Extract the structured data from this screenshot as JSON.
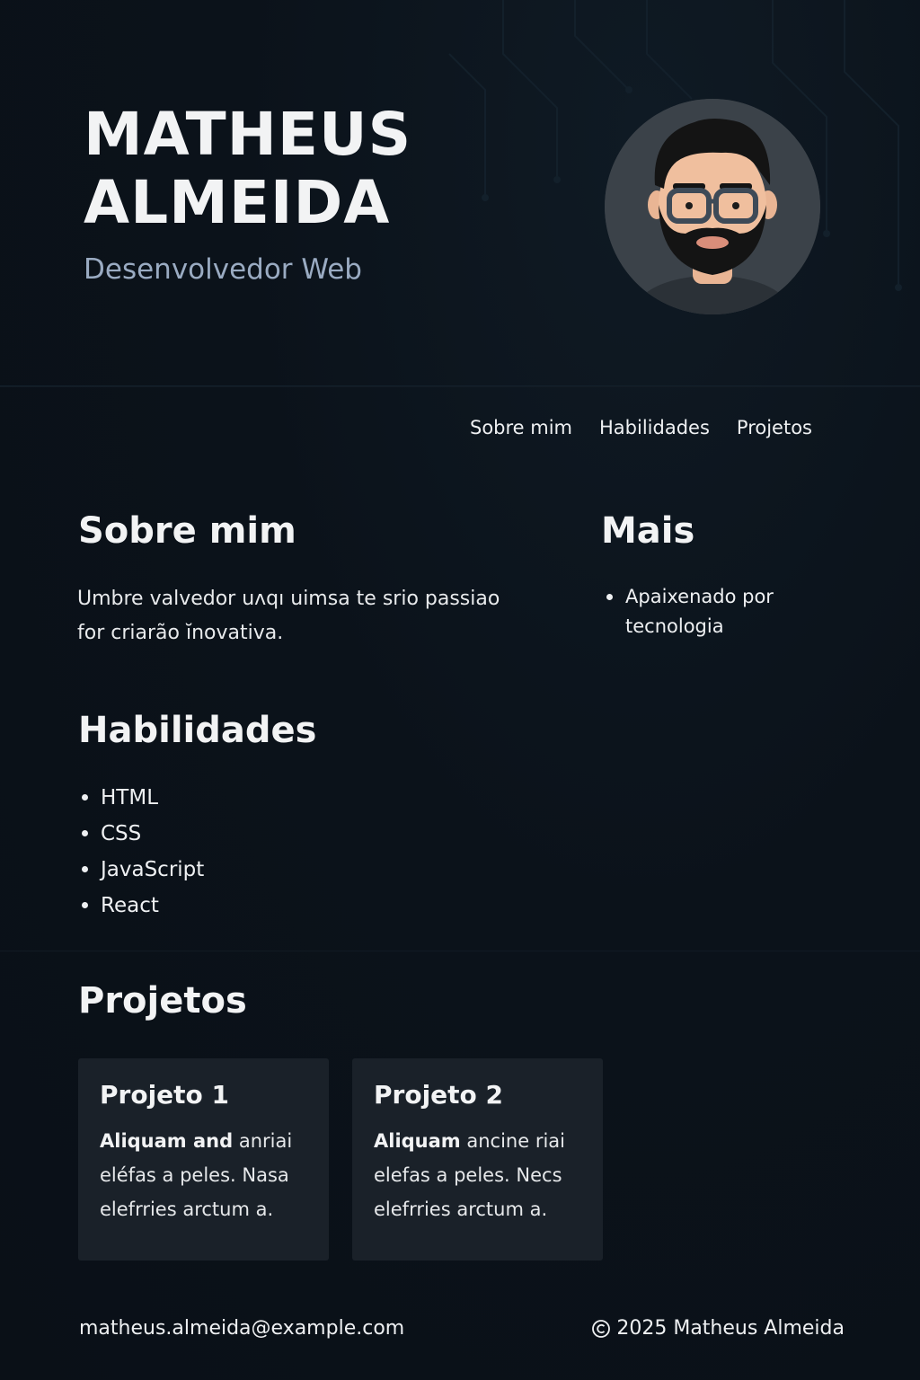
{
  "header": {
    "name_line1": "MATHEUS",
    "name_line2": "ALMEIDA",
    "subtitle": "Desenvolvedor Web"
  },
  "nav": {
    "items": [
      "Sobre mim",
      "Habilidades",
      "Projetos"
    ]
  },
  "about": {
    "title": "Sobre mim",
    "text": "Umbre valvedor uʌqı uimsa te srio passiao for criarão ĭnovativa."
  },
  "more": {
    "title": "Mais",
    "items": [
      "Apaixenado por tecnologia"
    ]
  },
  "skills": {
    "title": "Habilidades",
    "items": [
      "HTML",
      "CSS",
      "JavaScript",
      "React"
    ]
  },
  "projects": {
    "title": "Projetos",
    "items": [
      {
        "title": "Projeto 1",
        "lead": "Aliquam and",
        "text": " anriai eléfas a peles. Nasa elefrries arctum a."
      },
      {
        "title": "Projeto 2",
        "lead": "Aliquam",
        "text": " ancine riai elefas a peles. Necs elefrries arctum a."
      }
    ]
  },
  "footer": {
    "email": "matheus.almeida@example.com",
    "copyright": "2025 Matheus Almeida",
    "copyright_icon": "copyright-icon"
  },
  "colors": {
    "background": "#0b121a",
    "subtitle": "#9aabc2",
    "card": "#1a2129",
    "text": "#f1f3f5"
  }
}
